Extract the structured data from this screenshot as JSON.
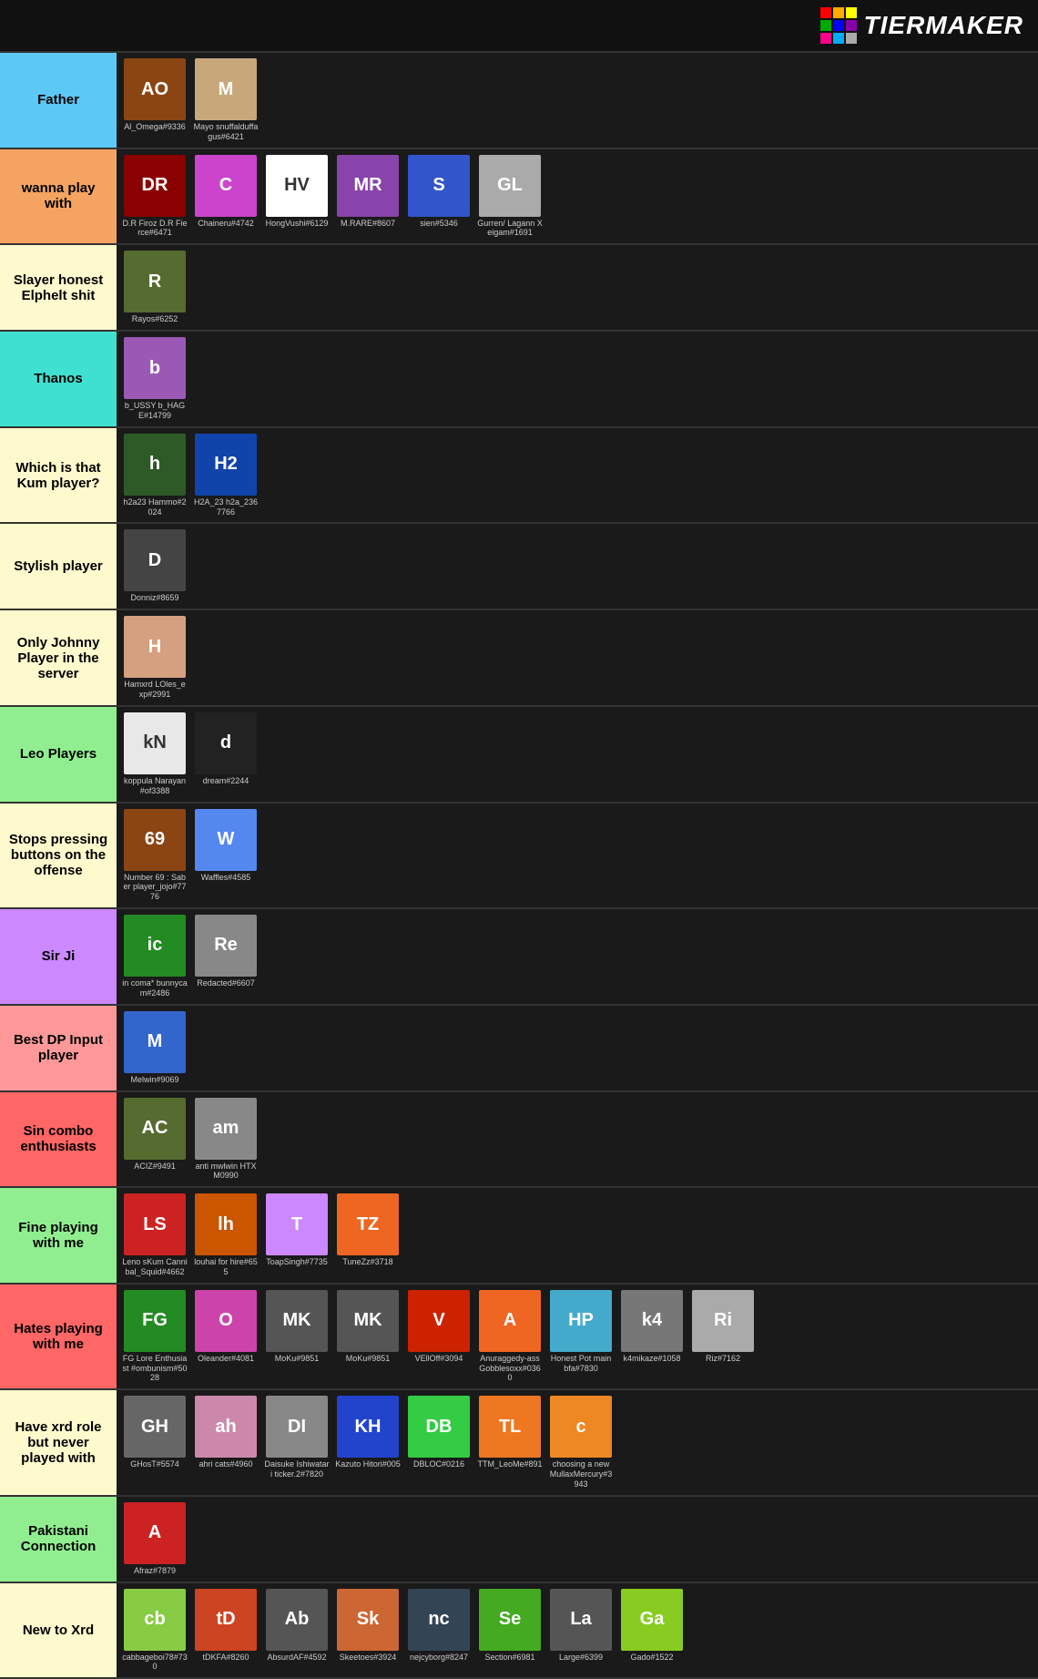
{
  "header": {
    "title": "TiERMAKER"
  },
  "tiers": [
    {
      "id": "father",
      "label": "Father",
      "color": "#5bc8f5",
      "players": [
        {
          "name": "Al_Omega#9336",
          "bg": "#8B4513",
          "initials": "AO"
        },
        {
          "name": "Mayo\nsnuffalduffagus#6421",
          "bg": "#c8a87a",
          "initials": "M"
        }
      ]
    },
    {
      "id": "wanna-play",
      "label": "wanna play with",
      "color": "#f4a460",
      "players": [
        {
          "name": "D.R Firoz\nD.R Fierce#6471",
          "bg": "#8B0000",
          "initials": "DR"
        },
        {
          "name": "Chaineru#4742",
          "bg": "#cc44cc",
          "initials": "C"
        },
        {
          "name": "HongVushi#6129",
          "bg": "#fff",
          "initials": "HV",
          "dark": true
        },
        {
          "name": "M.RARE#8607",
          "bg": "#8844aa",
          "initials": "MR"
        },
        {
          "name": "sien#5346",
          "bg": "#3355cc",
          "initials": "S"
        },
        {
          "name": "Gurren/ Lagann\nXeigam#1691",
          "bg": "#aaaaaa",
          "initials": "GL"
        }
      ]
    },
    {
      "id": "slayer",
      "label": "Slayer honest Elphelt shit",
      "color": "#fffacd",
      "players": [
        {
          "name": "Rayos#6252",
          "bg": "#556B2F",
          "initials": "R"
        }
      ]
    },
    {
      "id": "thanos",
      "label": "Thanos",
      "color": "#40e0d0",
      "players": [
        {
          "name": "b_USSY\nb_HAGE#14799",
          "bg": "#9B59B6",
          "initials": "b"
        }
      ]
    },
    {
      "id": "kum",
      "label": "Which is that Kum player?",
      "color": "#fffacd",
      "players": [
        {
          "name": "h2a23\nHammo#2024",
          "bg": "#2d5a27",
          "initials": "h"
        },
        {
          "name": "H2A_23\nh2a_2367766",
          "bg": "#1144aa",
          "initials": "H2"
        }
      ]
    },
    {
      "id": "stylish",
      "label": "Stylish player",
      "color": "#fffacd",
      "players": [
        {
          "name": "Donniz#8659",
          "bg": "#444",
          "initials": "D"
        }
      ]
    },
    {
      "id": "johnny",
      "label": "Only Johnny Player in the server",
      "color": "#fffacd",
      "players": [
        {
          "name": "Hamxrd\nLOles_exp#2991",
          "bg": "#d4a080",
          "initials": "H"
        }
      ]
    },
    {
      "id": "leo",
      "label": "Leo Players",
      "color": "#90EE90",
      "players": [
        {
          "name": "koppula Narayan\n#of3388",
          "bg": "#e8e8e8",
          "initials": "kN",
          "dark": true
        },
        {
          "name": "dream#2244",
          "bg": "#222",
          "initials": "d"
        }
      ]
    },
    {
      "id": "stops-pressing",
      "label": "Stops pressing buttons on the offense",
      "color": "#fffacd",
      "players": [
        {
          "name": "Number 69 : Saber\nplayer_jojo#7776",
          "bg": "#8B4513",
          "initials": "69"
        },
        {
          "name": "Waffles#4585",
          "bg": "#5588ee",
          "initials": "W"
        }
      ]
    },
    {
      "id": "sir-ji",
      "label": "Sir Ji",
      "color": "#cc88ff",
      "players": [
        {
          "name": "in coma*\nbunnycam#2486",
          "bg": "#228B22",
          "initials": "ic"
        },
        {
          "name": "Redacted#6607",
          "bg": "#888",
          "initials": "Re"
        }
      ]
    },
    {
      "id": "best-dp",
      "label": "Best DP Input player",
      "color": "#ff9999",
      "players": [
        {
          "name": "Melwin#9069",
          "bg": "#3366cc",
          "initials": "M"
        }
      ]
    },
    {
      "id": "sin-combo",
      "label": "Sin combo enthusiasts",
      "color": "#ff6666",
      "players": [
        {
          "name": "ACIZ#9491",
          "bg": "#556B2F",
          "initials": "AC"
        },
        {
          "name": "anti mwlwin\nHTXM0990",
          "bg": "#888",
          "initials": "am"
        }
      ]
    },
    {
      "id": "fine-playing",
      "label": "Fine playing with me",
      "color": "#90EE90",
      "players": [
        {
          "name": "Leno sKum\nCannibal_Squid#4662",
          "bg": "#cc2222",
          "initials": "LS"
        },
        {
          "name": "louhai for hire#655",
          "bg": "#cc5500",
          "initials": "lh"
        },
        {
          "name": "ToapSingh#7735",
          "bg": "#cc88ff",
          "initials": "T"
        },
        {
          "name": "TuneZz#3718",
          "bg": "#ee6622",
          "initials": "TZ"
        }
      ]
    },
    {
      "id": "hates-playing",
      "label": "Hates playing with me",
      "color": "#ff6666",
      "players": [
        {
          "name": "FG Lore Enthusiast\n#ombunism#5028",
          "bg": "#228B22",
          "initials": "FG"
        },
        {
          "name": "Oleander#4081",
          "bg": "#cc44aa",
          "initials": "O"
        },
        {
          "name": "MoKu#9851",
          "bg": "#555",
          "initials": "MK"
        },
        {
          "name": "MoKu#9851",
          "bg": "#555",
          "initials": "MK"
        },
        {
          "name": "VEllOff#3094",
          "bg": "#cc2200",
          "initials": "V"
        },
        {
          "name": "Anuraggedy-ass\nGobblesoxx#0360",
          "bg": "#ee6622",
          "initials": "A"
        },
        {
          "name": "Honest Pot main\nbfa#7830",
          "bg": "#44aacc",
          "initials": "HP"
        },
        {
          "name": "k4mikaze#1058",
          "bg": "#777",
          "initials": "k4"
        },
        {
          "name": "Riz#7162",
          "bg": "#aaa",
          "initials": "Ri"
        }
      ]
    },
    {
      "id": "have-xrd",
      "label": "Have xrd role but never played with",
      "color": "#fffacd",
      "players": [
        {
          "name": "GHosT#5574",
          "bg": "#666",
          "initials": "GH"
        },
        {
          "name": "ahri\ncats#4960",
          "bg": "#cc88aa",
          "initials": "ah"
        },
        {
          "name": "Daisuke Ishiwatari\nticker.2#7820",
          "bg": "#888",
          "initials": "DI"
        },
        {
          "name": "Kazuto Hitori#005",
          "bg": "#2244cc",
          "initials": "KH"
        },
        {
          "name": "DBLOC#0216",
          "bg": "#33cc44",
          "initials": "DB"
        },
        {
          "name": "TTM_LeoMe#891",
          "bg": "#ee7722",
          "initials": "TL"
        },
        {
          "name": "choosing a new\nMullaxMercury#3943",
          "bg": "#ee8822",
          "initials": "c"
        }
      ]
    },
    {
      "id": "pakistani",
      "label": "Pakistani Connection",
      "color": "#90EE90",
      "players": [
        {
          "name": "Afraz#7879",
          "bg": "#cc2222",
          "initials": "A"
        }
      ]
    },
    {
      "id": "new-xrd",
      "label": "New to Xrd",
      "color": "#fffacd",
      "players": [
        {
          "name": "cabbageboi78#730",
          "bg": "#88cc44",
          "initials": "cb"
        },
        {
          "name": "tDKFA#8260",
          "bg": "#cc4422",
          "initials": "tD"
        },
        {
          "name": "AbsurdAF#4592",
          "bg": "#555",
          "initials": "Ab"
        },
        {
          "name": "Skeetoes#3924",
          "bg": "#cc6633",
          "initials": "Sk"
        },
        {
          "name": "nejcyborg#8247",
          "bg": "#334455",
          "initials": "nc"
        },
        {
          "name": "Section#6981",
          "bg": "#44aa22",
          "initials": "Se"
        },
        {
          "name": "Large#6399",
          "bg": "#555",
          "initials": "La"
        },
        {
          "name": "Gado#1522",
          "bg": "#88cc22",
          "initials": "Ga"
        }
      ]
    }
  ],
  "logo": {
    "text": "TiERMAKER",
    "grid_colors": [
      "#ff0000",
      "#ffaa00",
      "#ffff00",
      "#00aa00",
      "#0000ff",
      "#8800aa",
      "#ff0088",
      "#00aaff",
      "#aaaaaa"
    ]
  }
}
